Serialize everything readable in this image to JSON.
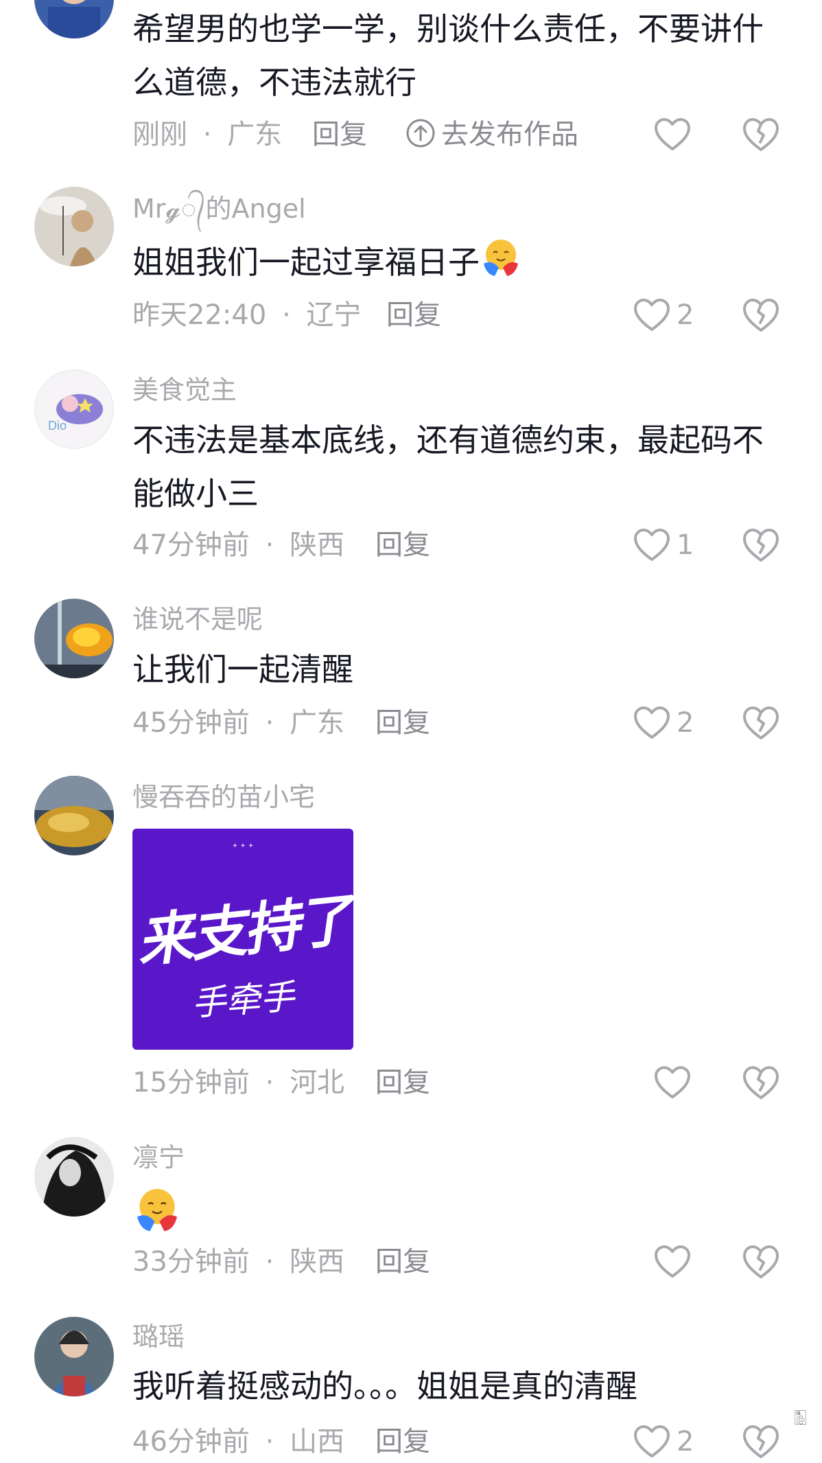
{
  "comments": [
    {
      "username": "",
      "text": "希望男的也学一学，别谈什么责任，不要讲什么道德，不违法就行",
      "time": "刚刚",
      "location": "广东",
      "reply": "回复",
      "publish": "去发布作品",
      "likes": ""
    },
    {
      "username": "Mr𝓰᭄的Angel",
      "text": "姐姐我们一起过享福日子",
      "emoji": "hug-emoji",
      "time": "昨天22:40",
      "location": "辽宁",
      "reply": "回复",
      "likes": "2"
    },
    {
      "username": "美食觉主",
      "text": "不违法是基本底线，还有道德约束，最起码不能做小三",
      "time": "47分钟前",
      "location": "陕西",
      "reply": "回复",
      "likes": "1"
    },
    {
      "username": "谁说不是呢",
      "text": "让我们一起清醒",
      "time": "45分钟前",
      "location": "广东",
      "reply": "回复",
      "likes": "2"
    },
    {
      "username": "慢吞吞的苗小宅",
      "sticker_title": "来支持了",
      "sticker_sub": "手牵手",
      "time": "15分钟前",
      "location": "河北",
      "reply": "回复",
      "likes": ""
    },
    {
      "username": "凛宁",
      "emoji": "hug-emoji",
      "time": "33分钟前",
      "location": "陕西",
      "reply": "回复",
      "likes": ""
    },
    {
      "username": "璐瑶",
      "text": "我听着挺感动的。。。姐姐是真的清醒",
      "time": "46分钟前",
      "location": "山西",
      "reply": "回复",
      "likes": "2"
    }
  ],
  "separator": "·",
  "colors": {
    "text": "#161823",
    "meta": "#a8a9ad",
    "sticker": "#5a17c9"
  },
  "watermark": "🀢"
}
